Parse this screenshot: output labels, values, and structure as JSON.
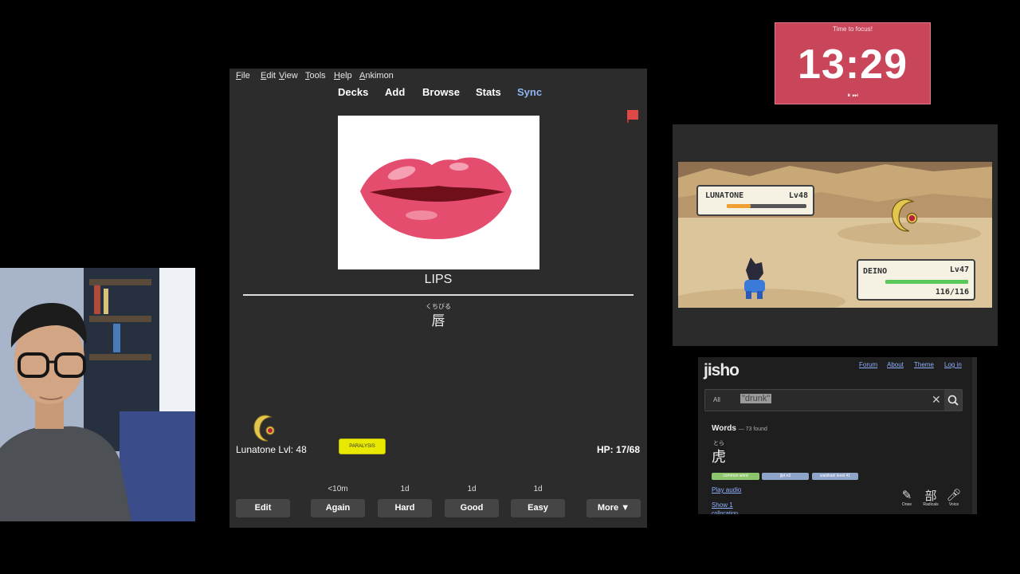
{
  "timer": {
    "title": "Time to focus!",
    "time": "13:29",
    "controls": "⏸ ⏭"
  },
  "anki": {
    "menu": [
      "File",
      "Edit",
      "View",
      "Tools",
      "Help",
      "Ankimon"
    ],
    "toolbar": [
      "Decks",
      "Add",
      "Browse",
      "Stats",
      "Sync"
    ],
    "card": {
      "word": "LIPS",
      "reading": "くちびる",
      "kanji": "唇"
    },
    "pokemon": {
      "name": "Lunatone Lvl: 48",
      "status": "PARALYSIS",
      "hp": "HP: 17/68"
    },
    "intervals": [
      "<10m",
      "1d",
      "1d",
      "1d"
    ],
    "buttons": {
      "edit": "Edit",
      "again": "Again",
      "hard": "Hard",
      "good": "Good",
      "easy": "Easy",
      "more": "More ▼"
    }
  },
  "game": {
    "enemy": {
      "name": "LUNATONE",
      "level": "Lv48"
    },
    "player": {
      "name": "DEINO",
      "level": "Lv47",
      "hp": "116/116"
    }
  },
  "jisho": {
    "logo": "jisho",
    "nav": [
      "Forum",
      "About",
      "Theme",
      "Log in"
    ],
    "search": {
      "filter": "All",
      "query": "\"drunk\""
    },
    "results": {
      "heading": "Words",
      "count": "— 73 found"
    },
    "entry": {
      "furigana": "とら",
      "word": "虎",
      "tags": [
        "common word",
        "jlpt n3",
        "wanikani level 41"
      ]
    },
    "links": [
      "Play audio",
      "Show 1",
      "collocation"
    ],
    "tools": [
      "Draw",
      "Radicals",
      "Voice"
    ]
  }
}
